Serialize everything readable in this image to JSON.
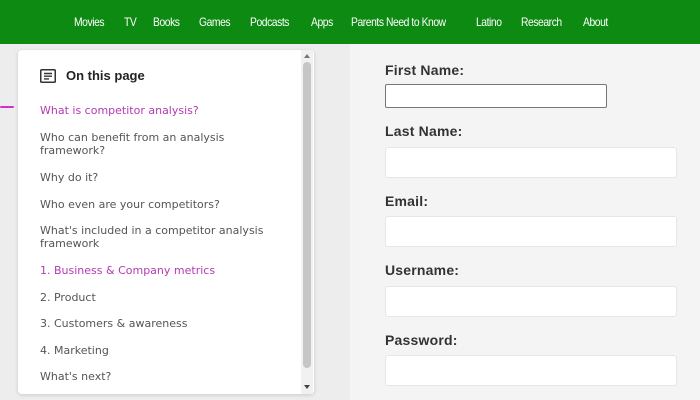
{
  "nav": {
    "items": [
      "Movies",
      "TV",
      "Books",
      "Games",
      "Podcasts",
      "Apps",
      "Parents Need to Know",
      "Latino",
      "Research",
      "About"
    ]
  },
  "toc": {
    "title": "On this page",
    "icon": "list-icon",
    "active_index": 0,
    "items": [
      {
        "label": "What is competitor analysis?",
        "accent": true
      },
      {
        "label": "Who can benefit from an analysis framework?",
        "accent": false
      },
      {
        "label": "Why do it?",
        "accent": false
      },
      {
        "label": "Who even are your competitors?",
        "accent": false
      },
      {
        "label": "What's included in a competitor analysis framework",
        "accent": false
      },
      {
        "label": "1. Business & Company metrics",
        "accent": true
      },
      {
        "label": "2. Product",
        "accent": false
      },
      {
        "label": "3. Customers & awareness",
        "accent": false
      },
      {
        "label": "4. Marketing",
        "accent": false
      },
      {
        "label": "What's next?",
        "accent": false
      }
    ]
  },
  "form": {
    "fields": [
      {
        "label": "First Name:",
        "value": ""
      },
      {
        "label": "Last Name:",
        "value": ""
      },
      {
        "label": "Email:",
        "value": ""
      },
      {
        "label": "Username:",
        "value": ""
      },
      {
        "label": "Password:",
        "value": ""
      }
    ]
  },
  "colors": {
    "nav_bg": "#0d8a11",
    "accent": "#b43ab4",
    "active_marker": "#d12fd1"
  }
}
